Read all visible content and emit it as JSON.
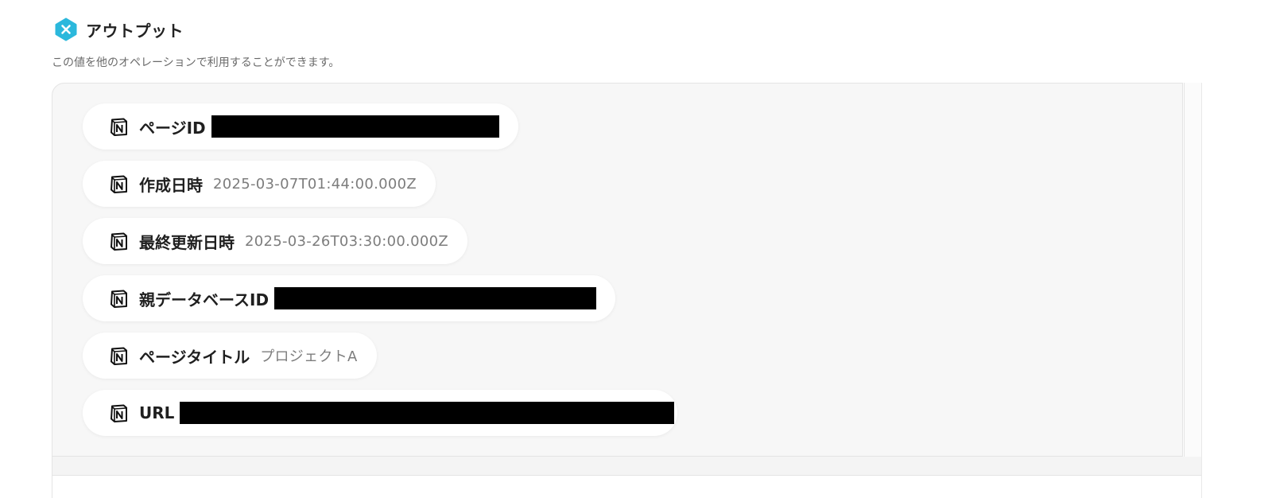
{
  "header": {
    "title": "アウトプット",
    "icon": "yoom-x-icon"
  },
  "description": "この値を他のオペレーションで利用することができます。",
  "colors": {
    "icon_accent": "#2bb8dc",
    "redaction": "#000000"
  },
  "outputs": [
    {
      "icon": "notion-icon",
      "label": "ページID",
      "value": null,
      "redacted": true
    },
    {
      "icon": "notion-icon",
      "label": "作成日時",
      "value": "2025-03-07T01:44:00.000Z",
      "redacted": false
    },
    {
      "icon": "notion-icon",
      "label": "最終更新日時",
      "value": "2025-03-26T03:30:00.000Z",
      "redacted": false
    },
    {
      "icon": "notion-icon",
      "label": "親データベースID",
      "value": null,
      "redacted": true
    },
    {
      "icon": "notion-icon",
      "label": "ページタイトル",
      "value": "プロジェクトA",
      "redacted": false
    },
    {
      "icon": "notion-icon",
      "label": "URL",
      "value": null,
      "redacted": true
    }
  ]
}
